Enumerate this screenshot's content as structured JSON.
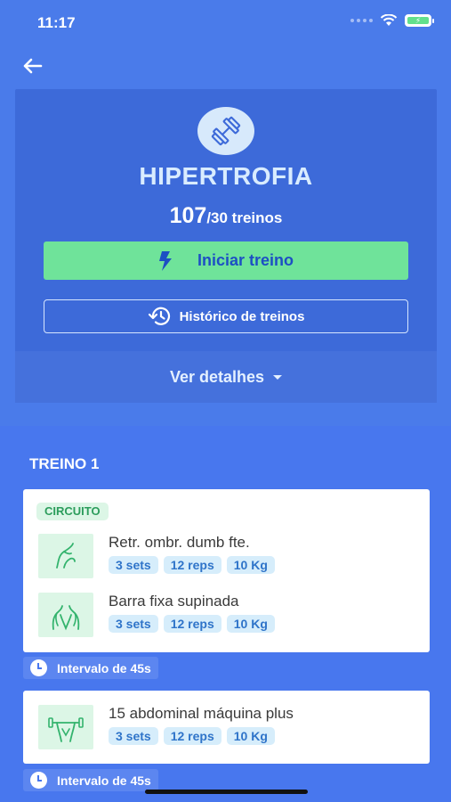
{
  "status": {
    "time": "11:17"
  },
  "program": {
    "title": "HIPERTROFIA",
    "count_done": "107",
    "count_total": "/30 treinos",
    "start_label": "Iniciar treino",
    "history_label": "Histórico de treinos",
    "details_label": "Ver detalhes"
  },
  "section": {
    "title": "TREINO 1"
  },
  "circuit": {
    "tag": "CIRCUITO",
    "exercises": [
      {
        "name": "Retr. ombr. dumb fte.",
        "sets": "3 sets",
        "reps": "12 reps",
        "weight": "10 Kg"
      },
      {
        "name": "Barra fixa supinada",
        "sets": "3 sets",
        "reps": "12 reps",
        "weight": "10 Kg"
      }
    ]
  },
  "interval_1": "Intervalo de 45s",
  "single": {
    "exercise": {
      "name": "15 abdominal máquina plus",
      "sets": "3 sets",
      "reps": "12 reps",
      "weight": "10 Kg"
    }
  },
  "interval_2": "Intervalo de 45s",
  "colors": {
    "background": "#4a7bea",
    "card": "#3d6ad9",
    "start_button": "#6fe39a",
    "accent_text": "#1d4fc4",
    "tag_green": "#2c9d5c",
    "chip_blue": "#2f74c9"
  },
  "icons": {
    "header": "dumbbell-icon",
    "start": "lightning-icon",
    "history": "history-clock-icon",
    "interval": "clock-icon"
  }
}
